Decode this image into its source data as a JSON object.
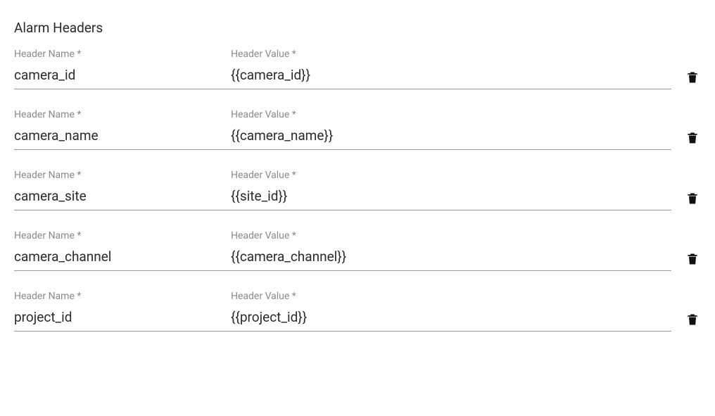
{
  "section_title": "Alarm Headers",
  "labels": {
    "name": "Header Name *",
    "value": "Header Value *"
  },
  "rows": [
    {
      "name": "camera_id",
      "value": "{{camera_id}}"
    },
    {
      "name": "camera_name",
      "value": "{{camera_name}}"
    },
    {
      "name": "camera_site",
      "value": "{{site_id}}"
    },
    {
      "name": "camera_channel",
      "value": "{{camera_channel}}"
    },
    {
      "name": "project_id",
      "value": "{{project_id}}"
    }
  ]
}
